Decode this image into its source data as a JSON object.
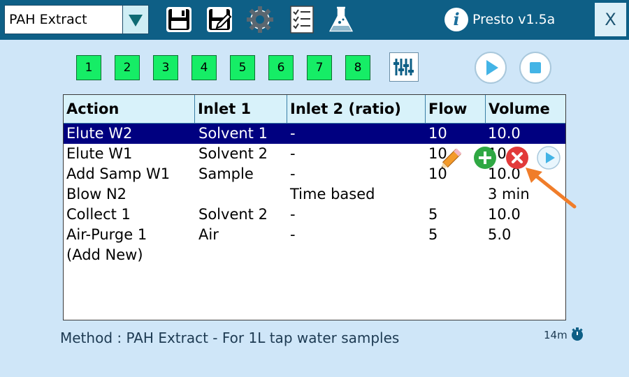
{
  "toolbar": {
    "method_value": "PAH Extract",
    "version": "Presto v1.5a",
    "close_label": "X",
    "tools": [
      "save-icon",
      "save-edit-icon",
      "gear-icon",
      "checklist-icon",
      "flask-icon"
    ]
  },
  "steps": [
    "1",
    "2",
    "3",
    "4",
    "5",
    "6",
    "7",
    "8"
  ],
  "table": {
    "columns": [
      "Action",
      "Inlet 1",
      "Inlet 2 (ratio)",
      "Flow",
      "Volume"
    ],
    "rows": [
      [
        "Elute W2",
        "Solvent 1",
        "-",
        "10",
        "10.0"
      ],
      [
        "Elute W1",
        "Solvent 2",
        "-",
        "10",
        "10.0"
      ],
      [
        "Add Samp W1",
        "Sample",
        "-",
        "10",
        "10.0"
      ],
      [
        "Blow N2",
        "",
        "Time based",
        "",
        "3 min"
      ],
      [
        "Collect 1",
        "Solvent 2",
        "-",
        "5",
        "10.0"
      ],
      [
        "Air-Purge 1",
        "Air",
        "-",
        "5",
        "5.0"
      ],
      [
        "(Add New)",
        "",
        "",
        "",
        ""
      ]
    ],
    "selected_row": 0
  },
  "status": {
    "method_text": "Method : PAH Extract - For 1L tap water samples",
    "timer": "14m"
  },
  "colors": {
    "topbar": "#0e5f86",
    "background": "#cfe6f8",
    "step_green": "#16ed66",
    "selection": "#000080",
    "annotation_arrow": "#f07d2a"
  }
}
